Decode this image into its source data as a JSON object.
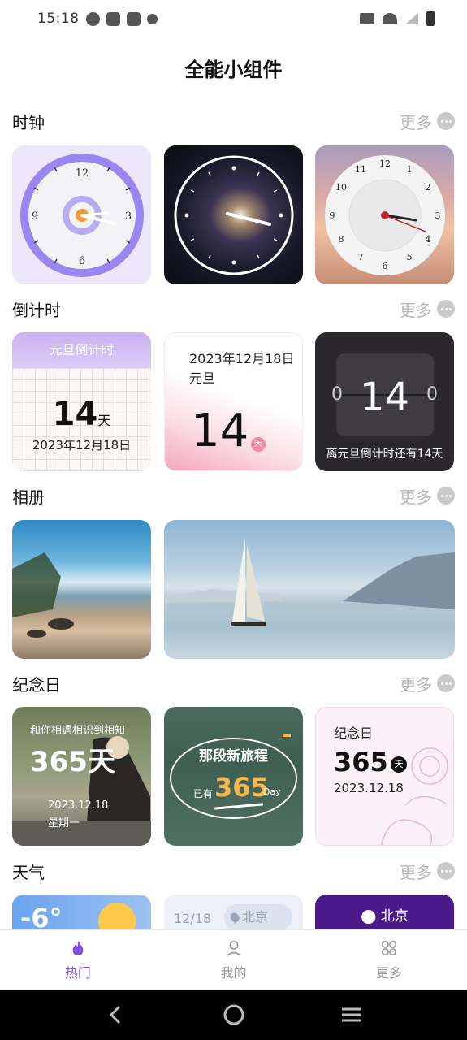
{
  "status_bar": {
    "time": "15:18"
  },
  "page": {
    "title": "全能小组件"
  },
  "more_label": "更多",
  "sections": {
    "clock": {
      "name": "时钟"
    },
    "countdown": {
      "name": "倒计时"
    },
    "album": {
      "name": "相册"
    },
    "anniversary": {
      "name": "纪念日"
    },
    "weather": {
      "name": "天气"
    }
  },
  "clocks": {
    "purple": {
      "numbers": [
        "12",
        "3",
        "6",
        "9"
      ]
    },
    "photo": {
      "numbers": [
        "12",
        "1",
        "2",
        "3",
        "4",
        "5",
        "6",
        "7",
        "8",
        "9",
        "10",
        "11"
      ]
    }
  },
  "countdown_widgets": {
    "c1": {
      "header": "元旦倒计时",
      "days": "14",
      "unit": "天",
      "date": "2023年12月18日"
    },
    "c2": {
      "date": "2023年12月18日",
      "event": "元旦",
      "days": "14",
      "unit": "天"
    },
    "c3": {
      "days": "14",
      "left_digit": "0",
      "right_digit": "0",
      "caption": "离元旦倒计时还有14天"
    }
  },
  "anniversary_widgets": {
    "a1": {
      "line1": "和你相遇相识到相知",
      "days": "365天",
      "date": "2023.12.18",
      "weekday": "星期一"
    },
    "a2": {
      "title": "那段新旅程",
      "prefix": "已有",
      "days": "365",
      "unit": "Day"
    },
    "a3": {
      "title": "纪念日",
      "days": "365",
      "unit": "天",
      "date": "2023.12.18"
    }
  },
  "weather_widgets": {
    "w1": {
      "temp": "-6°"
    },
    "w2": {
      "date": "12/18",
      "city": "北京"
    },
    "w3": {
      "city": "北京"
    }
  },
  "tabs": [
    {
      "label": "热门",
      "icon": "flame-icon",
      "active": true
    },
    {
      "label": "我的",
      "icon": "person-icon",
      "active": false
    },
    {
      "label": "更多",
      "icon": "grid-icon",
      "active": false
    }
  ],
  "colors": {
    "accent": "#7b4fe0",
    "clock_purple": "#9a86f0"
  }
}
